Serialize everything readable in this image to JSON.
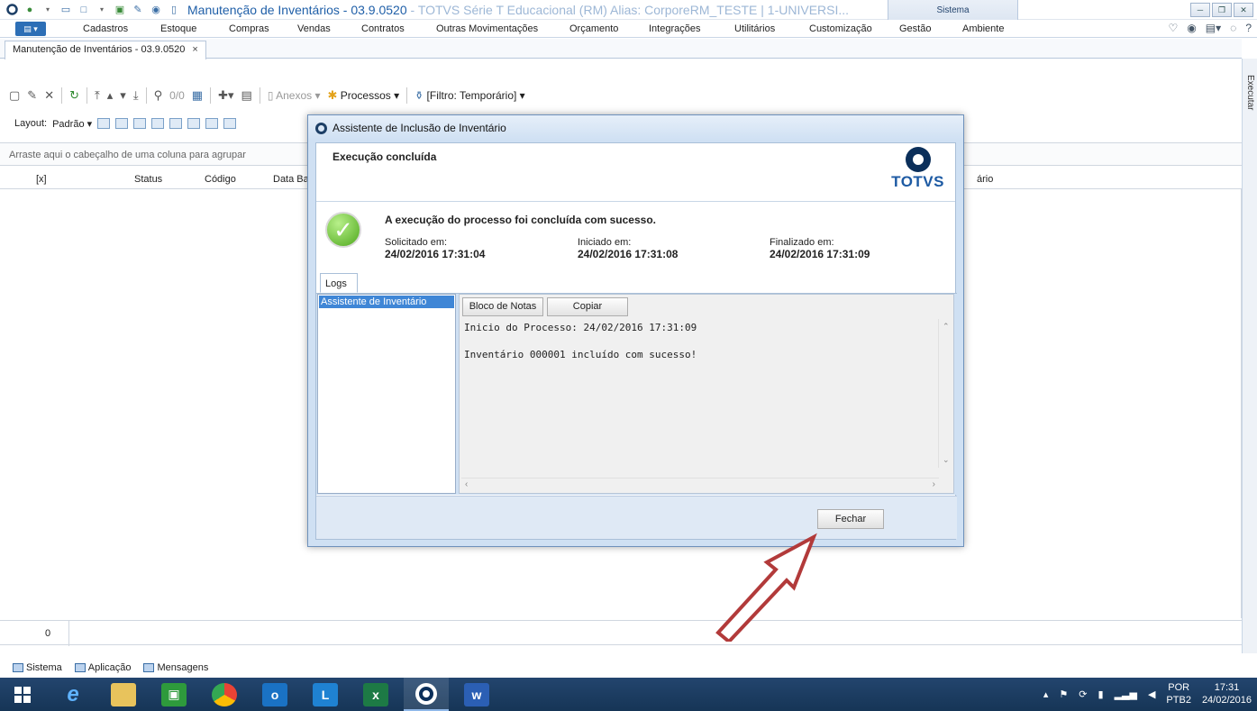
{
  "window": {
    "title": "Manutenção de Inventários - 03.9.0520",
    "title_suffix": " - TOTVS Série T Educacional (RM) Alias:  CorporeRM_TESTE | 1-UNIVERSI...",
    "sistema_tab": "Sistema"
  },
  "menu": {
    "items": [
      "Cadastros",
      "Estoque",
      "Compras",
      "Vendas",
      "Contratos",
      "Outras Movimentações",
      "Orçamento",
      "Integrações",
      "Utilitários",
      "Customização",
      "Gestão",
      "Ambiente"
    ]
  },
  "doc_tab": {
    "label": "Manutenção de Inventários - 03.9.0520",
    "close": "×"
  },
  "toolbar": {
    "record_count": "0/0",
    "anexos": "Anexos",
    "processos": "Processos",
    "filtro": "[Filtro: Temporário]"
  },
  "layoutbar": {
    "label": "Layout:",
    "padrao": "Padrão"
  },
  "grid": {
    "group_hint": "Arraste aqui o cabeçalho de uma coluna para agrupar",
    "columns": [
      "[x]",
      "Status",
      "Código",
      "Data Ba",
      "ário"
    ],
    "count": "0"
  },
  "side_panel": {
    "label": "Executar"
  },
  "statusbar": {
    "items": [
      "Sistema",
      "Aplicação",
      "Mensagens"
    ]
  },
  "taskbar": {
    "lang_top": "POR",
    "lang_bottom": "PTB2",
    "time": "17:31",
    "date": "24/02/2016"
  },
  "dialog": {
    "title": "Assistente de Inclusão de Inventário",
    "heading": "Execução concluída",
    "logo_text": "TOTVS",
    "success_message": "A execução do processo foi concluída com sucesso.",
    "solicitado_label": "Solicitado em:",
    "solicitado_value": "24/02/2016 17:31:04",
    "iniciado_label": "Iniciado em:",
    "iniciado_value": "24/02/2016 17:31:08",
    "finalizado_label": "Finalizado em:",
    "finalizado_value": "24/02/2016 17:31:09",
    "logs_tab": "Logs",
    "log_item": "Assistente de Inventário",
    "bloco_button": "Bloco de Notas",
    "copiar_button": "Copiar",
    "log_line1": "Inicio do Processo: 24/02/2016 17:31:09",
    "log_line2": "Inventário 000001 incluído com sucesso!",
    "close_button": "Fechar"
  },
  "colors": {
    "accent_blue": "#1f5fa8",
    "dialog_bg": "#cfe0f3",
    "arrow": "#b23a3a",
    "taskbar": "#1b3b61"
  }
}
